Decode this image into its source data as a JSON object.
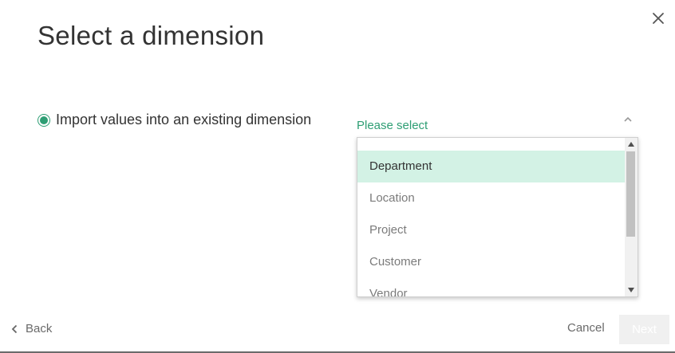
{
  "dialog": {
    "title": "Select a dimension",
    "close_icon": "close-icon"
  },
  "import_option": {
    "label": "Import values into an existing dimension",
    "selected": true
  },
  "dimension_select": {
    "placeholder": "Please select",
    "chevron_icon": "chevron-up-icon",
    "options": [
      {
        "label": "Department",
        "highlighted": true
      },
      {
        "label": "Location",
        "highlighted": false
      },
      {
        "label": "Project",
        "highlighted": false
      },
      {
        "label": "Customer",
        "highlighted": false
      },
      {
        "label": "Vendor",
        "highlighted": false
      }
    ]
  },
  "footer": {
    "back_label": "Back",
    "back_icon": "chevron-left-icon",
    "cancel_label": "Cancel",
    "next_label": "Next",
    "next_enabled": false
  },
  "colors": {
    "accent": "#2e9e74",
    "highlight": "#d3f2e5",
    "text": "#333333",
    "muted": "#7b7b7b"
  }
}
